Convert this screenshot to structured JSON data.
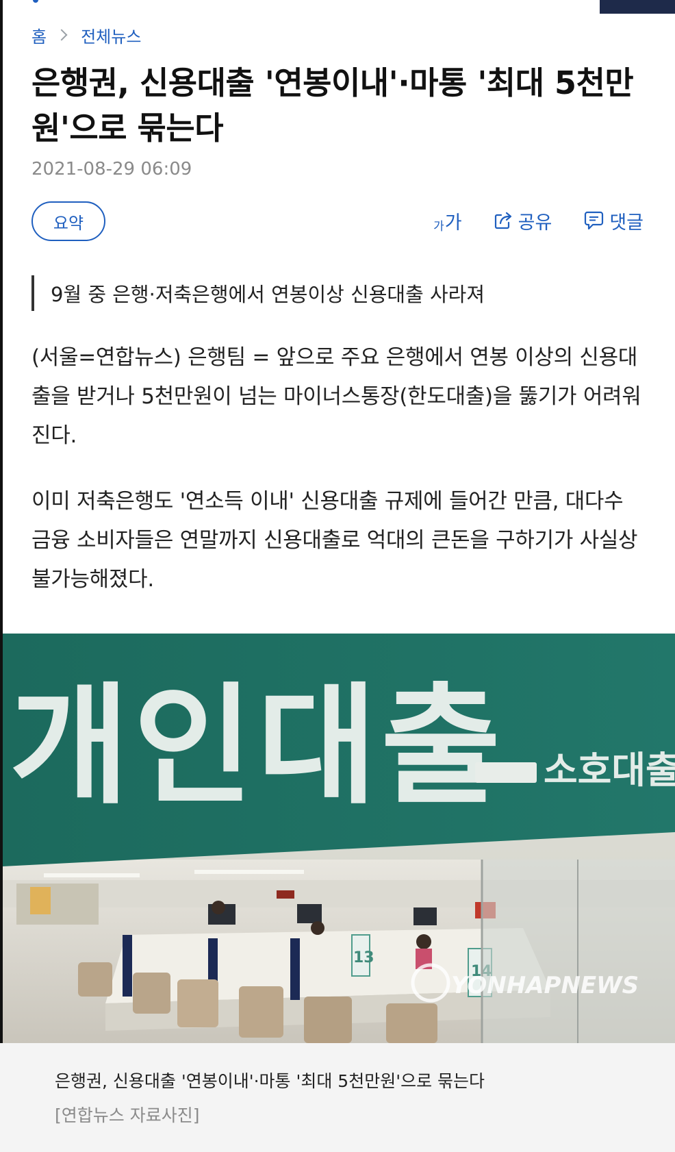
{
  "breadcrumb": {
    "home": "홈",
    "section": "전체뉴스"
  },
  "article": {
    "title_line1": "은행권, 신용대출 '연봉이내'·마통 '최대 5천만",
    "title_line2": "원'으로 묶는다",
    "date": "2021-08-29 06:09",
    "subhead": "9월 중 은행·저축은행에서 연봉이상 신용대출 사라져",
    "paragraph1": "(서울=연합뉴스) 은행팀 = 앞으로 주요 은행에서 연봉 이상의 신용대출을 받거나 5천만원이 넘는 마이너스통장(한도대출)을 뚫기가 어려워진다.",
    "paragraph2": "이미 저축은행도 '연소득 이내' 신용대출 규제에 들어간 만큼, 대다수 금융 소비자들은 연말까지 신용대출로 억대의 큰돈을 구하기가 사실상 불가능해졌다."
  },
  "toolbar": {
    "summary_label": "요약",
    "fontsize_small": "가",
    "fontsize_large": "가",
    "share_label": "공유",
    "comment_label": "댓글"
  },
  "photo": {
    "sign_text": "개인대출",
    "sign_subtext": "소호대출",
    "desk_number_1": "13",
    "desk_number_2": "14",
    "watermark": "YONHAPNEWS"
  },
  "caption": {
    "main": "은행권, 신용대출 '연봉이내'·마통 '최대 5천만원'으로 묶는다",
    "credit": "[연합뉴스 자료사진]"
  },
  "colors": {
    "accent": "#1f5fbf",
    "sign_green": "#1f6f63",
    "text": "#222222",
    "muted": "#8a8a8a"
  }
}
